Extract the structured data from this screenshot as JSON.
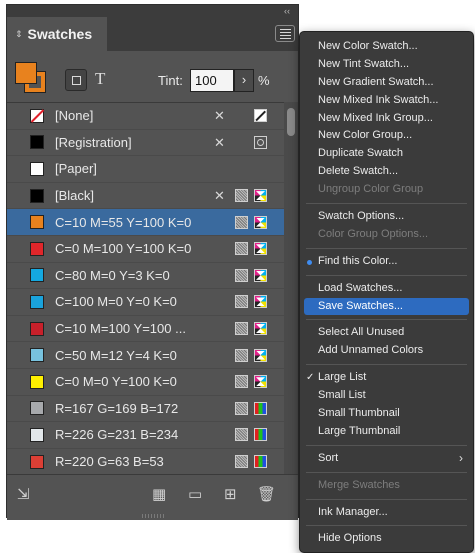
{
  "panel": {
    "title": "Swatches",
    "collapse_glyph": "‹‹",
    "tint_label": "Tint:",
    "tint_value": "100",
    "tint_arrow": "›",
    "tint_unit": "%",
    "text_format_glyph": "T",
    "fill_color": "#e8821e"
  },
  "swatches": [
    {
      "name": "[None]",
      "color": "none",
      "icons": [
        "noedit",
        "none"
      ]
    },
    {
      "name": "[Registration]",
      "color": "#000000",
      "icons": [
        "noedit",
        "reg"
      ]
    },
    {
      "name": "[Paper]",
      "color": "#ffffff",
      "icons": []
    },
    {
      "name": "[Black]",
      "color": "#000000",
      "icons": [
        "noedit",
        "spot",
        "cmyk"
      ]
    },
    {
      "name": "C=10 M=55 Y=100 K=0",
      "color": "#e8821e",
      "icons": [
        "spot",
        "cmyk"
      ],
      "selected": true
    },
    {
      "name": "C=0 M=100 Y=100 K=0",
      "color": "#e0262a",
      "icons": [
        "spot",
        "cmyk"
      ]
    },
    {
      "name": "C=80 M=0 Y=3 K=0",
      "color": "#14a8e0",
      "icons": [
        "spot",
        "cmyk"
      ]
    },
    {
      "name": "C=100 M=0 Y=0 K=0",
      "color": "#1aa3dc",
      "icons": [
        "spot",
        "cmyk"
      ]
    },
    {
      "name": "C=10 M=100 Y=100 ...",
      "color": "#c8202a",
      "icons": [
        "spot",
        "cmyk"
      ]
    },
    {
      "name": "C=50 M=12 Y=4 K=0",
      "color": "#78c2de",
      "icons": [
        "spot",
        "cmyk"
      ]
    },
    {
      "name": "C=0 M=0 Y=100 K=0",
      "color": "#fff000",
      "icons": [
        "spot",
        "cmyk"
      ]
    },
    {
      "name": "R=167 G=169 B=172",
      "color": "#a7a9ac",
      "icons": [
        "spot",
        "rgb"
      ]
    },
    {
      "name": "R=226 G=231 B=234",
      "color": "#e2e7ea",
      "icons": [
        "spot",
        "rgb"
      ]
    },
    {
      "name": "R=220 G=63 B=53",
      "color": "#dc3f35",
      "icons": [
        "spot",
        "rgb"
      ]
    }
  ],
  "bottom_icons": {
    "place": "⇲",
    "kind": "▦",
    "folder": "▭",
    "new": "⊞",
    "trash": "🗑"
  },
  "menu": {
    "items": [
      {
        "label": "New Color Swatch...",
        "type": "item"
      },
      {
        "label": "New Tint Swatch...",
        "type": "item"
      },
      {
        "label": "New Gradient Swatch...",
        "type": "item"
      },
      {
        "label": "New Mixed Ink Swatch...",
        "type": "item"
      },
      {
        "label": "New Mixed Ink Group...",
        "type": "item"
      },
      {
        "label": "New Color Group...",
        "type": "item"
      },
      {
        "label": "Duplicate Swatch",
        "type": "item"
      },
      {
        "label": "Delete Swatch...",
        "type": "item"
      },
      {
        "label": "Ungroup Color Group",
        "type": "disabled"
      },
      {
        "type": "sep"
      },
      {
        "label": "Swatch Options...",
        "type": "item"
      },
      {
        "label": "Color Group Options...",
        "type": "disabled"
      },
      {
        "type": "sep"
      },
      {
        "label": "Find this Color...",
        "type": "item",
        "dot": true
      },
      {
        "type": "sep"
      },
      {
        "label": "Load Swatches...",
        "type": "item"
      },
      {
        "label": "Save Swatches...",
        "type": "highlight"
      },
      {
        "type": "sep"
      },
      {
        "label": "Select All Unused",
        "type": "item"
      },
      {
        "label": "Add Unnamed Colors",
        "type": "item"
      },
      {
        "type": "sep"
      },
      {
        "label": "Large List",
        "type": "item",
        "check": true
      },
      {
        "label": "Small List",
        "type": "item"
      },
      {
        "label": "Small Thumbnail",
        "type": "item"
      },
      {
        "label": "Large Thumbnail",
        "type": "item"
      },
      {
        "type": "sep"
      },
      {
        "label": "Sort",
        "type": "item",
        "submenu": true
      },
      {
        "type": "sep"
      },
      {
        "label": "Merge Swatches",
        "type": "disabled"
      },
      {
        "type": "sep"
      },
      {
        "label": "Ink Manager...",
        "type": "item"
      },
      {
        "type": "sep"
      },
      {
        "label": "Hide Options",
        "type": "item"
      }
    ]
  }
}
